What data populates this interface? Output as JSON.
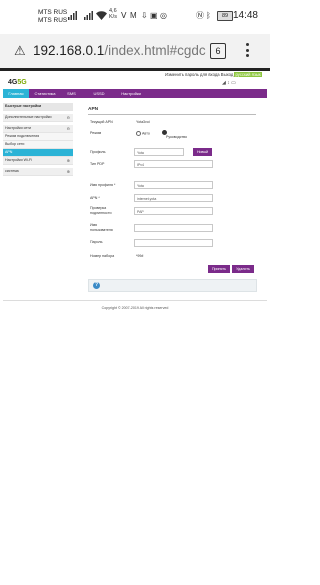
{
  "status": {
    "carrier1": "MTS RUS",
    "carrier2": "MTS RUS",
    "speed_value": "4,6",
    "speed_unit": "K/s",
    "battery": "89",
    "time": "14:48"
  },
  "browser": {
    "url_host": "192.168.0.1",
    "url_path": "/index.html#cgdc",
    "tab_count": "6"
  },
  "header": {
    "logo_prefix": "4G",
    "logo_rest": "5G",
    "change_password": "Изменить пароль для входа",
    "logout": "Выход",
    "language": "русский язык"
  },
  "nav": {
    "items": [
      "Главная",
      "Статистика",
      "SMS",
      "USSD",
      "Настройки"
    ]
  },
  "sidebar": {
    "items": [
      {
        "label": "Быстрые настройки"
      },
      {
        "label": "Дополнительные настройки"
      },
      {
        "label": "Настройки сети"
      },
      {
        "label": "Режим подключения"
      },
      {
        "label": "Выбор сети"
      },
      {
        "label": "APN"
      },
      {
        "label": "Настройки Wi-Fi"
      },
      {
        "label": "система"
      }
    ]
  },
  "apn": {
    "title": "APN",
    "current_apn_label": "Текущий APN",
    "current_apn_value": "Yota3voi",
    "mode_label": "Режим",
    "mode_auto": "Авто",
    "mode_manual": "Руководство",
    "profile_label": "Профиль",
    "profile_value": "Yota",
    "new_button": "Новый",
    "pdp_label": "Тип PDP",
    "pdp_value": "IPv4",
    "profile_name_label": "Имя профиля *",
    "profile_name_value": "Yota",
    "apn_label": "APN *",
    "apn_value": "internet.yota",
    "auth_label": "Проверка подлинности",
    "auth_value": "PAP",
    "user_label": "Имя пользователя",
    "password_label": "Пароль",
    "dial_label": "Номер набора",
    "dial_value": "*99#",
    "apply_button": "Принять",
    "delete_button": "Удалить"
  },
  "footer": {
    "copyright": "Copyright © 2007-2019 All rights reserved"
  }
}
